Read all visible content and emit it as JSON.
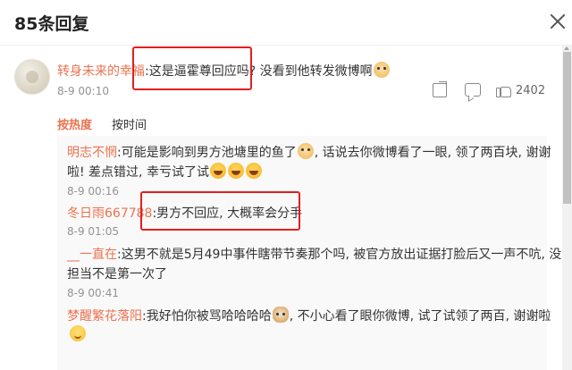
{
  "header": {
    "title": "85条回复"
  },
  "main_comment": {
    "username": "转身未来的幸福",
    "text_before": ":这是逼霍尊回应吗?",
    "text_after": "没看到他转发微博啊",
    "time": "8-9 00:10",
    "like_count": "2402"
  },
  "sort_tabs": [
    {
      "label": "按热度",
      "active": true
    },
    {
      "label": "按时间",
      "active": false
    }
  ],
  "replies": [
    {
      "username": "明志不惘",
      "text_line1": ":可能是影响到男方池塘里的鱼了",
      "text_line1b": ", 话说去你微博看了一眼, 领了两百块, 谢谢",
      "text_line2": "啦! 差点错过, 幸亏试了试",
      "time": "8-9 00:16"
    },
    {
      "username": "冬日雨667788",
      "text": ":男方不回应, 大概率会分手",
      "time": "8-9 01:05"
    },
    {
      "username": "__一直在",
      "text_line1": ":这男不就是5月49中事件瞎带节奏那个吗, 被官方放出证据打脸后又一声不吭, 没",
      "text_line2": "担当不是第一次了",
      "time": "8-9 00:41"
    },
    {
      "username": "梦醒繁花落阳",
      "text_line1a": ":我好怕你被骂哈哈哈哈",
      "text_line1b": ", 不小心看了眼你微博, 试了试领了两百, 谢谢啦",
      "time": ""
    }
  ],
  "colors": {
    "accent": "#eb7350",
    "highlight_box": "#e0201e",
    "reply_bg": "#f9f9f9"
  },
  "icons": [
    "close-icon",
    "share-icon",
    "comment-icon",
    "like-icon"
  ]
}
